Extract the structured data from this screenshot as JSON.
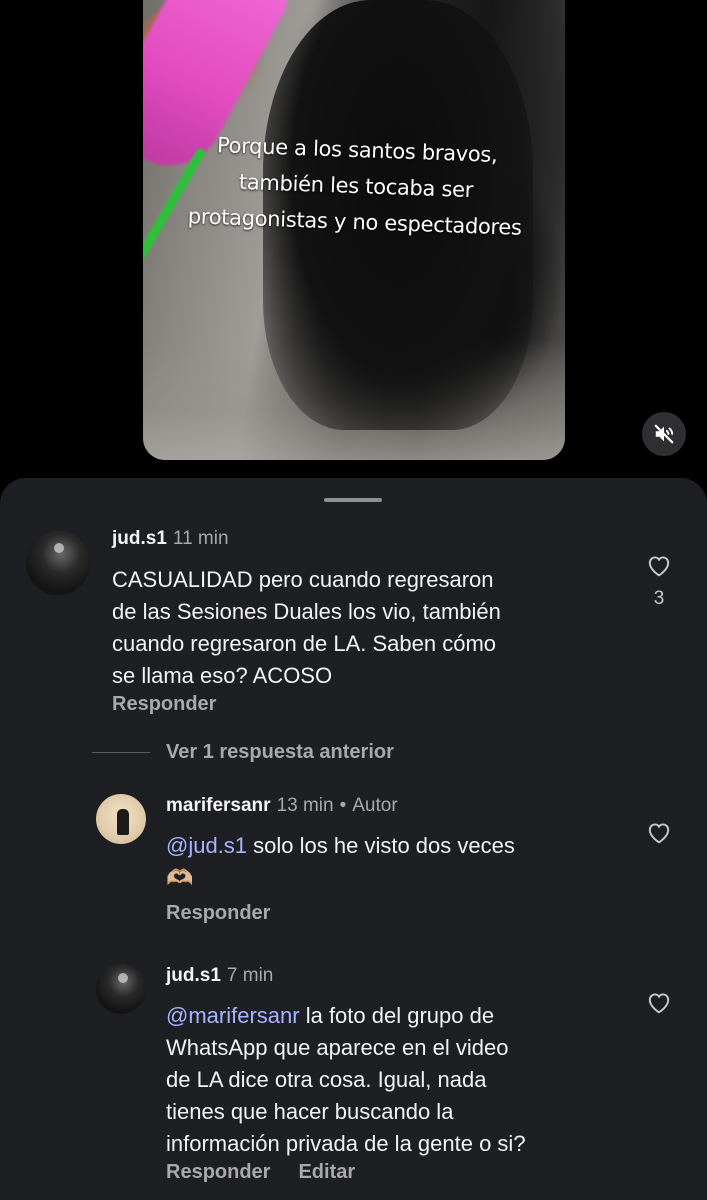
{
  "video": {
    "caption": "Porque a los santos bravos,\ntambién les tocaba ser\nprotagonistas y no espectadores",
    "mute_icon": "speaker-muted-icon"
  },
  "comments": [
    {
      "username": "jud.s1",
      "time": "11 min",
      "text": "CASUALIDAD pero cuando regresaron\nde las Sesiones Duales los vio, también\ncuando regresaron de LA. Saben cómo\nse llama eso? ACOSO",
      "likes": "3",
      "reply_label": "Responder"
    }
  ],
  "view_previous_replies": "Ver 1 respuesta anterior",
  "replies": [
    {
      "username": "marifersanr",
      "time": "13 min",
      "separator": "•",
      "badge": "Autor",
      "mention": "@jud.s1",
      "text": " solo los he visto dos veces\n🫶🏼",
      "reply_label": "Responder"
    },
    {
      "username": "jud.s1",
      "time": "7 min",
      "mention": "@marifersanr",
      "text": " la foto del grupo de\nWhatsApp que aparece en el video\nde LA dice otra cosa. Igual, nada\ntienes que hacer buscando la\ninformación privada de la gente o si?",
      "reply_label": "Responder",
      "edit_label": "Editar"
    }
  ]
}
